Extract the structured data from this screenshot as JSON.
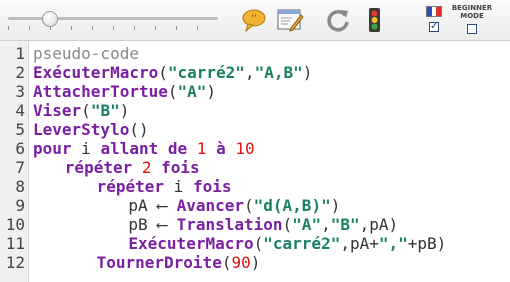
{
  "toolbar": {
    "speed_slider_fraction": 0.2,
    "icons": [
      "speech-bubble-icon",
      "edit-window-icon",
      "refresh-icon",
      "traffic-light-icon"
    ],
    "beginner_mode": {
      "line1": "BEGINNER",
      "line2": "MODE",
      "checked": false
    },
    "french_flag_checked": true
  },
  "colors": {
    "keyword": "#7a1fa2",
    "string": "#1b7f64",
    "number": "#dd1111",
    "comment": "#888888",
    "plain": "#333333"
  },
  "editor": {
    "lines": [
      {
        "n": "1",
        "indent": 0,
        "tokens": [
          {
            "t": "pseudo-code",
            "c": "cm"
          }
        ]
      },
      {
        "n": "2",
        "indent": 0,
        "tokens": [
          {
            "t": "ExécuterMacro",
            "c": "kw"
          },
          {
            "t": "(",
            "c": "pl"
          },
          {
            "t": "\"carré2\"",
            "c": "str"
          },
          {
            "t": ",",
            "c": "pl"
          },
          {
            "t": "\"A,B\"",
            "c": "str"
          },
          {
            "t": ")",
            "c": "pl"
          }
        ]
      },
      {
        "n": "3",
        "indent": 0,
        "tokens": [
          {
            "t": "AttacherTortue",
            "c": "kw"
          },
          {
            "t": "(",
            "c": "pl"
          },
          {
            "t": "\"A\"",
            "c": "str"
          },
          {
            "t": ")",
            "c": "pl"
          }
        ]
      },
      {
        "n": "4",
        "indent": 0,
        "tokens": [
          {
            "t": "Viser",
            "c": "kw"
          },
          {
            "t": "(",
            "c": "pl"
          },
          {
            "t": "\"B\"",
            "c": "str"
          },
          {
            "t": ")",
            "c": "pl"
          }
        ]
      },
      {
        "n": "5",
        "indent": 0,
        "tokens": [
          {
            "t": "LeverStylo",
            "c": "kw"
          },
          {
            "t": "()",
            "c": "pl"
          }
        ]
      },
      {
        "n": "6",
        "indent": 0,
        "tokens": [
          {
            "t": "pour",
            "c": "kw"
          },
          {
            "t": " i ",
            "c": "pl"
          },
          {
            "t": "allant de",
            "c": "kw"
          },
          {
            "t": " ",
            "c": "pl"
          },
          {
            "t": "1",
            "c": "num"
          },
          {
            "t": " ",
            "c": "pl"
          },
          {
            "t": "à",
            "c": "kw"
          },
          {
            "t": " ",
            "c": "pl"
          },
          {
            "t": "10",
            "c": "num"
          }
        ]
      },
      {
        "n": "7",
        "indent": 3,
        "tokens": [
          {
            "t": "répéter",
            "c": "kw"
          },
          {
            "t": " ",
            "c": "pl"
          },
          {
            "t": "2",
            "c": "num"
          },
          {
            "t": " ",
            "c": "pl"
          },
          {
            "t": "fois",
            "c": "kw"
          }
        ]
      },
      {
        "n": "8",
        "indent": 6,
        "tokens": [
          {
            "t": "répéter",
            "c": "kw"
          },
          {
            "t": " i ",
            "c": "pl"
          },
          {
            "t": "fois",
            "c": "kw"
          }
        ]
      },
      {
        "n": "9",
        "indent": 9,
        "tokens": [
          {
            "t": "pA ⟵ ",
            "c": "pl"
          },
          {
            "t": "Avancer",
            "c": "kw"
          },
          {
            "t": "(",
            "c": "pl"
          },
          {
            "t": "\"d(A,B)\"",
            "c": "str"
          },
          {
            "t": ")",
            "c": "pl"
          }
        ]
      },
      {
        "n": "10",
        "indent": 9,
        "tokens": [
          {
            "t": "pB ⟵ ",
            "c": "pl"
          },
          {
            "t": "Translation",
            "c": "kw"
          },
          {
            "t": "(",
            "c": "pl"
          },
          {
            "t": "\"A\"",
            "c": "str"
          },
          {
            "t": ",",
            "c": "pl"
          },
          {
            "t": "\"B\"",
            "c": "str"
          },
          {
            "t": ",pA)",
            "c": "pl"
          }
        ]
      },
      {
        "n": "11",
        "indent": 9,
        "tokens": [
          {
            "t": "ExécuterMacro",
            "c": "kw"
          },
          {
            "t": "(",
            "c": "pl"
          },
          {
            "t": "\"carré2\"",
            "c": "str"
          },
          {
            "t": ",pA+",
            "c": "pl"
          },
          {
            "t": "\",\"",
            "c": "str"
          },
          {
            "t": "+pB)",
            "c": "pl"
          }
        ]
      },
      {
        "n": "12",
        "indent": 6,
        "tokens": [
          {
            "t": "TournerDroite",
            "c": "kw"
          },
          {
            "t": "(",
            "c": "pl"
          },
          {
            "t": "90",
            "c": "num"
          },
          {
            "t": ")",
            "c": "pl"
          }
        ]
      }
    ]
  }
}
